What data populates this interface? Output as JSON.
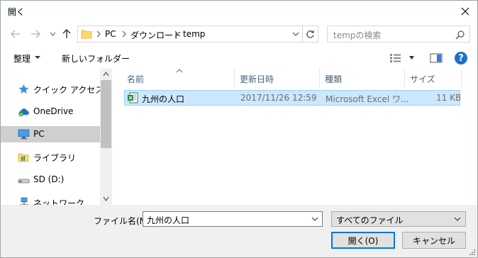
{
  "window": {
    "title": "開く"
  },
  "nav": {
    "crumbs": [
      "PC",
      "ダウンロード",
      "temp"
    ],
    "search_placeholder": "tempの検索"
  },
  "toolbar": {
    "organize_label": "整理",
    "new_folder_label": "新しいフォルダー"
  },
  "navpane": {
    "items": [
      {
        "label": "クイック アクセス",
        "icon": "star-icon"
      },
      {
        "label": "OneDrive",
        "icon": "cloud-icon"
      },
      {
        "label": "PC",
        "icon": "computer-icon",
        "selected": true
      },
      {
        "label": "ライブラリ",
        "icon": "library-icon"
      },
      {
        "label": "SD (D:)",
        "icon": "drive-icon"
      },
      {
        "label": "ネットワーク",
        "icon": "network-icon"
      }
    ]
  },
  "filelist": {
    "columns": [
      "名前",
      "更新日時",
      "種類",
      "サイズ"
    ],
    "rows": [
      {
        "name": "九州の人口",
        "modified": "2017/11/26 12:59",
        "type": "Microsoft Excel ワ...",
        "size": "11 KB",
        "icon": "excel-file-icon",
        "selected": true
      }
    ]
  },
  "bottom": {
    "filename_label": "ファイル名(N):",
    "filename_value": "九州の人口",
    "filetype_value": "すべてのファイル",
    "open_label": "開く(O)",
    "cancel_label": "キャンセル"
  },
  "colors": {
    "selection_bg": "#cce8ff",
    "selection_border": "#99d1ff",
    "nav_selected": "#cfcfcf",
    "accent": "#0078d7"
  }
}
